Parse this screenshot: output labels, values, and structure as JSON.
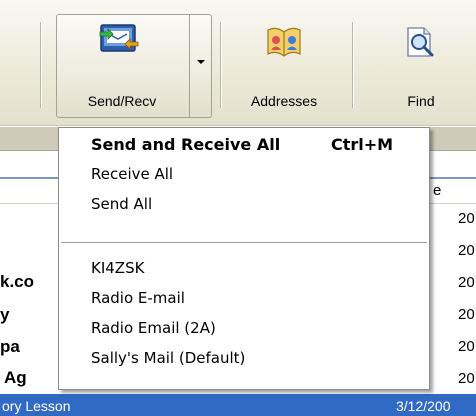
{
  "toolbar": {
    "send_recv_label": "Send/Recv",
    "addresses_label": "Addresses",
    "find_label": "Find",
    "icons": {
      "send_recv": "send-receive-icon",
      "dropdown": "dropdown-arrow-icon",
      "addresses": "address-book-icon",
      "find": "find-icon"
    }
  },
  "menu": {
    "items": [
      {
        "label": "Send and Receive All",
        "shortcut": "Ctrl+M",
        "default": true
      },
      {
        "label": "Receive All"
      },
      {
        "label": "Send All"
      },
      {
        "label": "KI4ZSK"
      },
      {
        "label": "Radio E-mail"
      },
      {
        "label": "Radio Email (2A)"
      },
      {
        "label": "Sally's Mail (Default)"
      }
    ]
  },
  "background": {
    "column_fragment": "e",
    "rows": [
      {
        "text": "",
        "date": "20"
      },
      {
        "text": "k.co",
        "date": "20"
      },
      {
        "text": "y",
        "date": "20"
      },
      {
        "text": "pa",
        "date": "20"
      },
      {
        "text": "Ag",
        "date": "20"
      }
    ],
    "selected_row": {
      "text": "ory Lesson",
      "date": "3/12/200"
    }
  },
  "colors": {
    "toolbar_bg": "#ece9d8",
    "selection": "#316ac5",
    "menu_bg": "#ffffff"
  }
}
